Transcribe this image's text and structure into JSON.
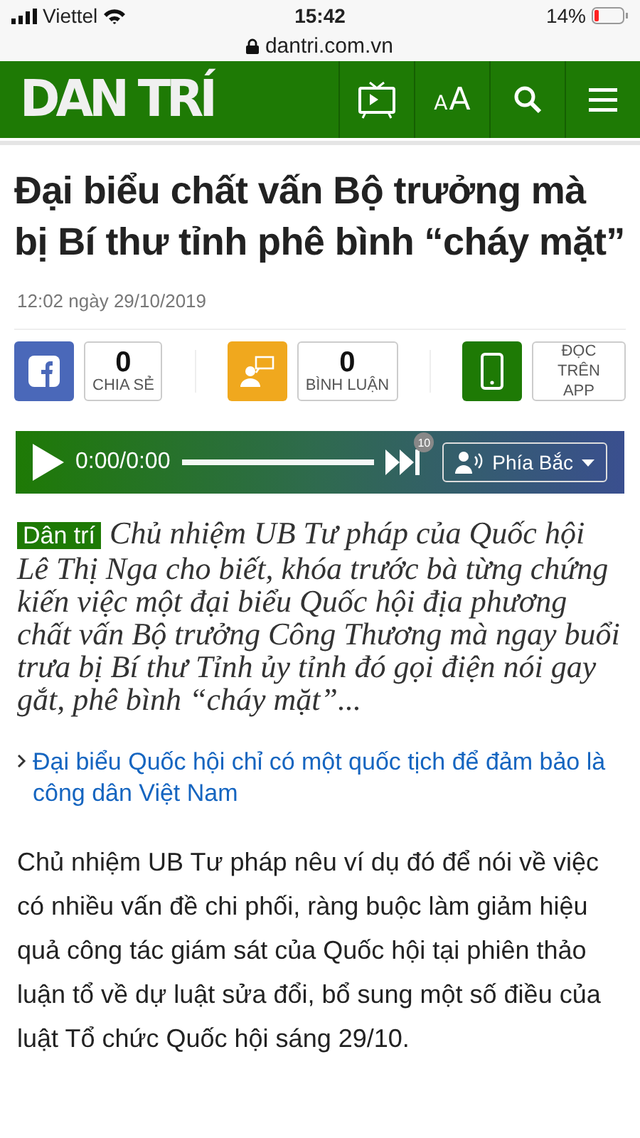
{
  "status_bar": {
    "carrier": "Viettel",
    "time": "15:42",
    "battery": "14%"
  },
  "address_bar": {
    "url": "dantri.com.vn"
  },
  "header": {
    "logo": "DAN TRÍ",
    "font_button": {
      "small": "A",
      "large": "A"
    }
  },
  "article": {
    "title": "Đại biểu chất vấn Bộ trưởng mà bị Bí thư tỉnh phê bình “cháy mặt”",
    "date": "12:02 ngày 29/10/2019",
    "actions": [
      {
        "kind": "facebook",
        "count": "0",
        "label": "CHIA SẺ"
      },
      {
        "kind": "comment",
        "count": "0",
        "label": "BÌNH LUẬN"
      },
      {
        "kind": "app",
        "label": "ĐỌC TRÊN APP"
      }
    ],
    "player": {
      "time": "0:00/0:00",
      "skip_badge": "10",
      "voice": "Phía Bắc"
    },
    "source_tag": "Dân trí",
    "lead": "Chủ nhiệm UB Tư pháp của Quốc hội Lê Thị Nga cho biết, khóa trước bà từng chứng kiến việc một đại biểu Quốc hội địa phương chất vấn Bộ trưởng Công Thương mà ngay buổi trưa bị Bí thư Tỉnh ủy tỉnh đó gọi điện nói gay gắt, phê bình “cháy mặt”...",
    "related_link": "Đại biểu Quốc hội chỉ có một quốc tịch để đảm bảo là công dân Việt Nam",
    "body": "Chủ nhiệm UB Tư pháp nêu ví dụ đó để nói về việc có nhiều vấn đề chi phối, ràng buộc làm giảm hiệu quả công tác giám sát của Quốc hội tại phiên thảo luận tổ về dự luật sửa đổi, bổ sung một số điều của luật Tổ chức Quốc hội sáng 29/10."
  }
}
